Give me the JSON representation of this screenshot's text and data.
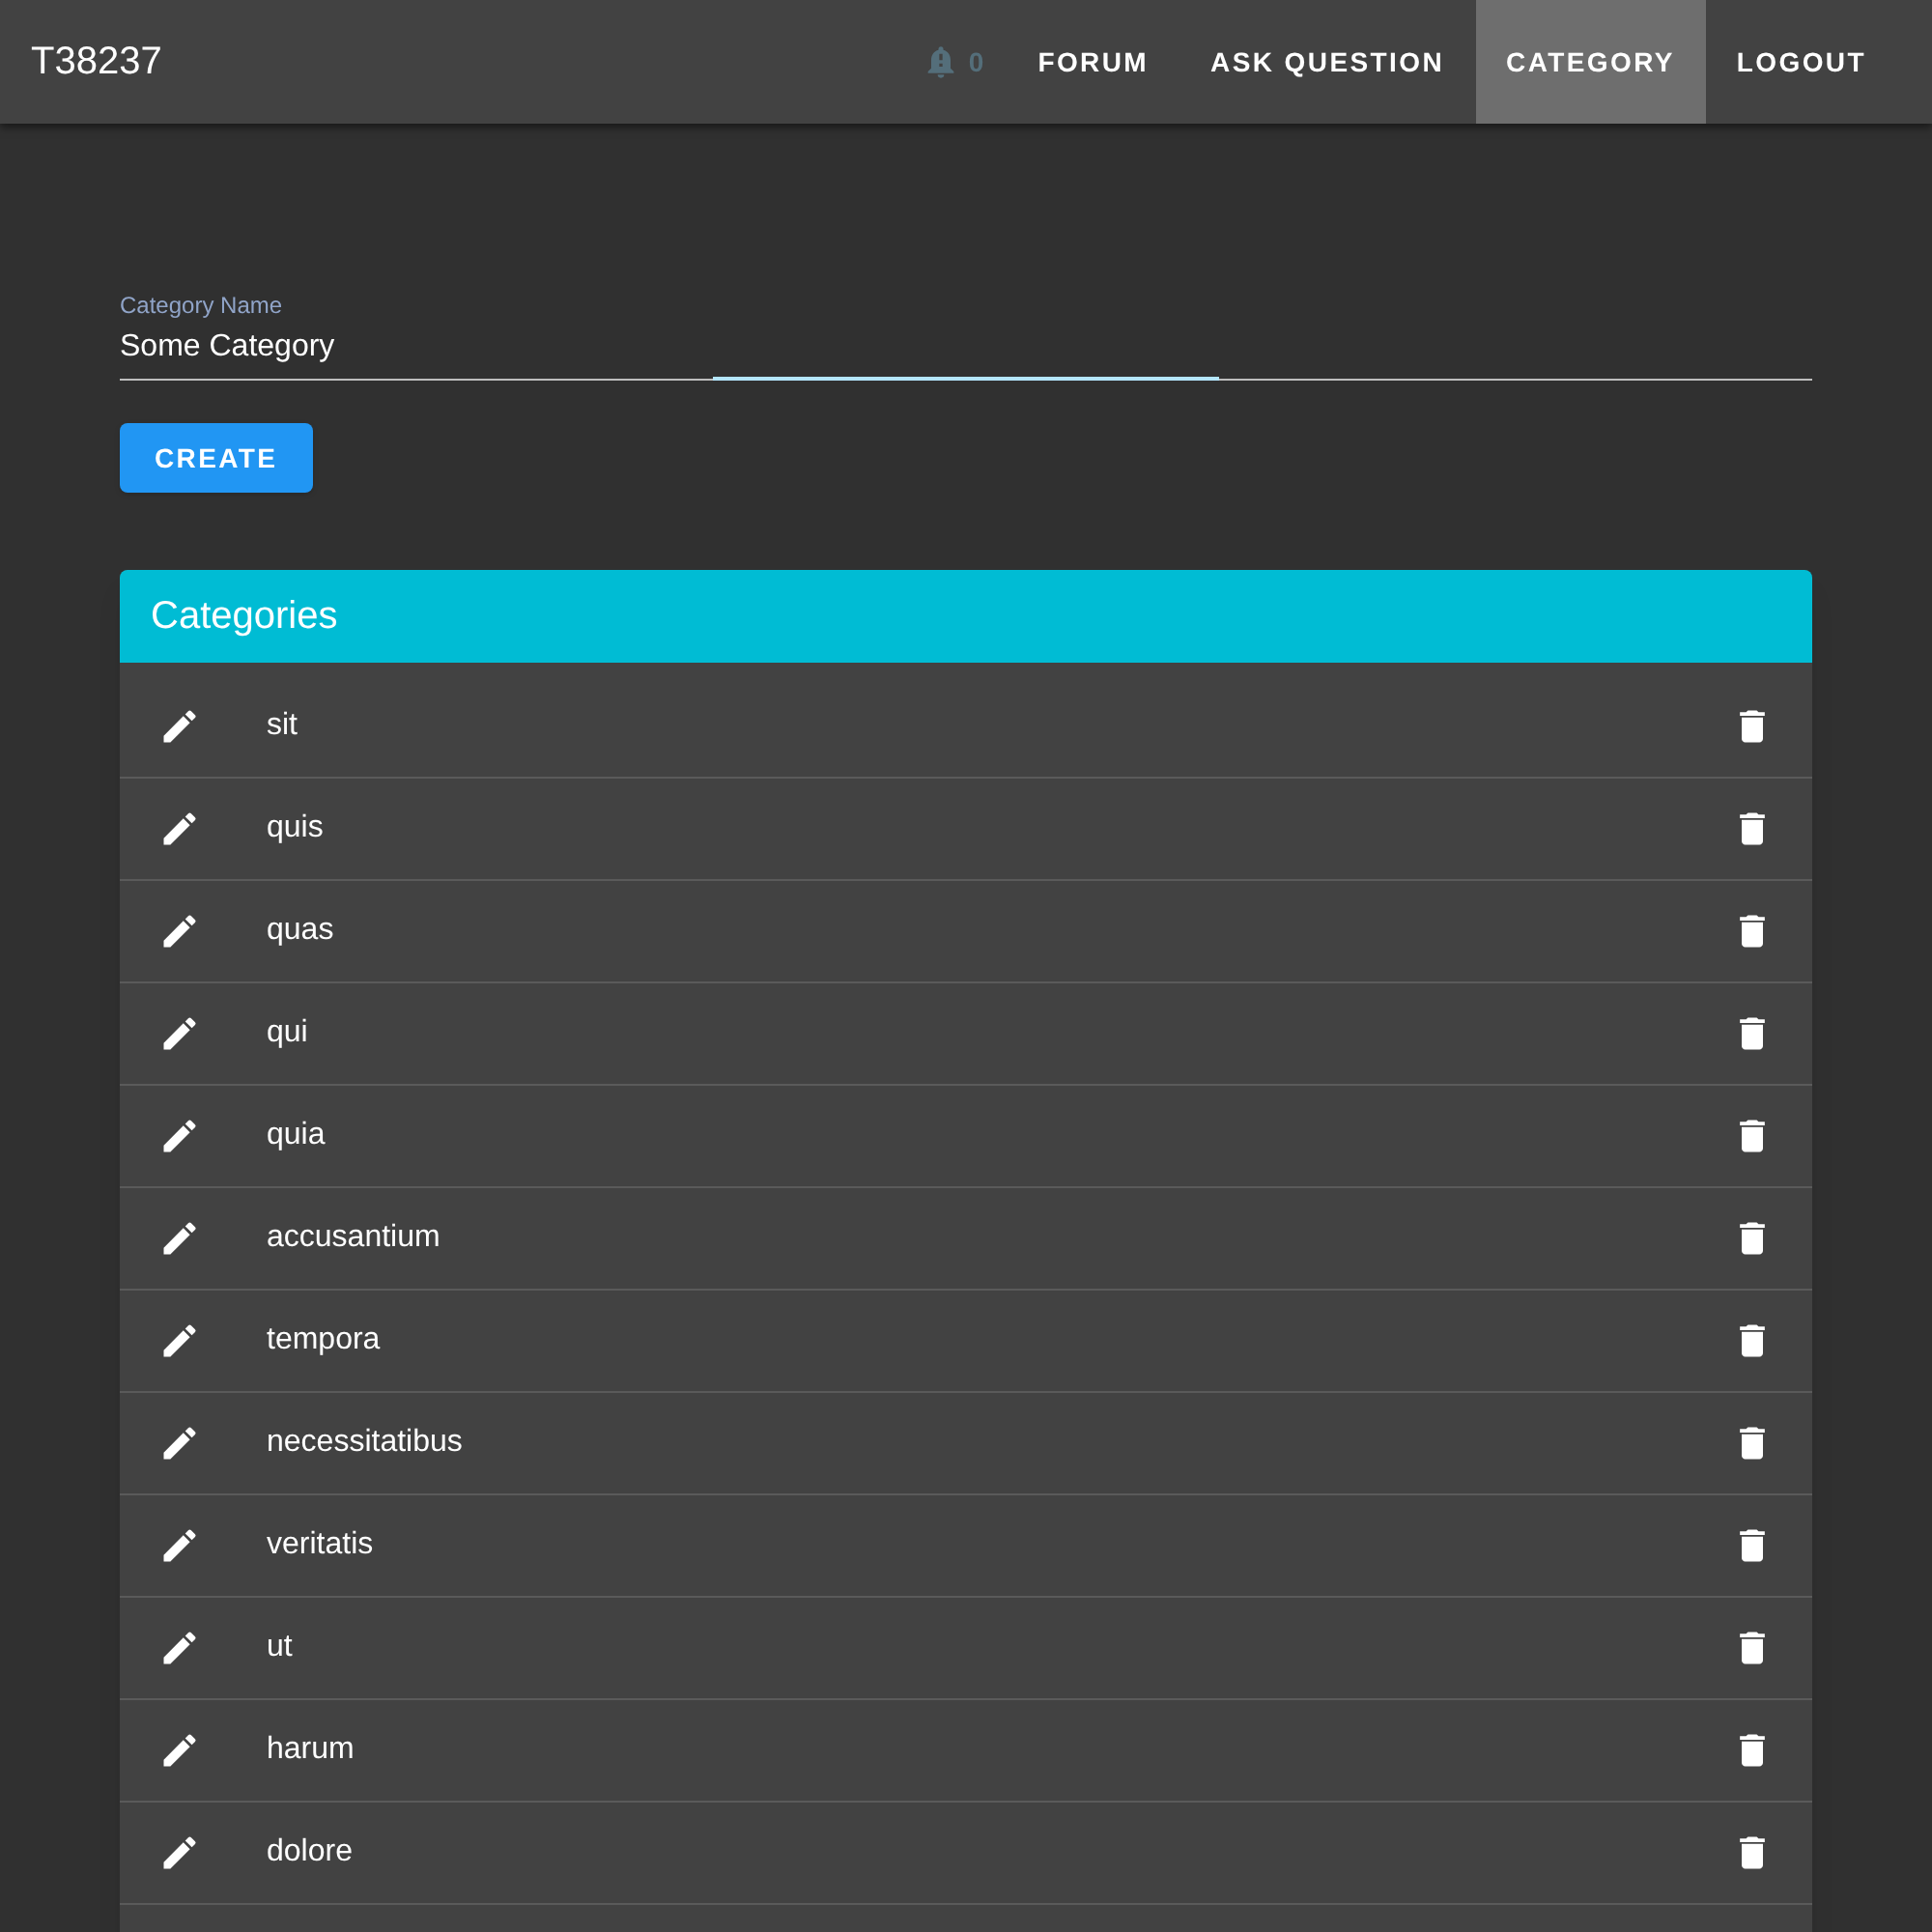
{
  "app_bar": {
    "title": "T38237",
    "notifications": {
      "count": "0"
    },
    "nav": [
      {
        "label": "FORUM",
        "selected": false
      },
      {
        "label": "ASK QUESTION",
        "selected": false
      },
      {
        "label": "CATEGORY",
        "selected": true
      },
      {
        "label": "LOGOUT",
        "selected": false
      }
    ]
  },
  "form": {
    "field": {
      "label": "Category Name",
      "value": "Some Category"
    },
    "button": "CREATE"
  },
  "categories": {
    "title": "Categories",
    "items": [
      "sit",
      "quis",
      "quas",
      "qui",
      "quia",
      "accusantium",
      "tempora",
      "necessitatibus",
      "veritatis",
      "ut",
      "harum",
      "dolore"
    ]
  }
}
